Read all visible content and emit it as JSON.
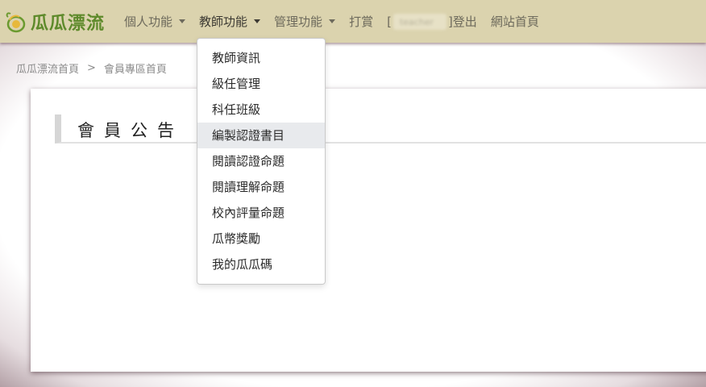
{
  "brand": {
    "name": "瓜瓜漂流",
    "logo_icon": "melon-logo-icon",
    "logo_color": "#5e8a2b"
  },
  "nav": {
    "personal": "個人功能",
    "teacher": "教師功能",
    "admin": "管理功能",
    "tip": "打賞",
    "user_open": "[",
    "user_name": "teacher",
    "user_close": "]",
    "logout": "登出",
    "home": "網站首頁"
  },
  "breadcrumb": {
    "root": "瓜瓜漂流首頁",
    "separator": ">",
    "current": "會員專區首頁"
  },
  "main": {
    "section_title": "會員公告"
  },
  "teacher_menu": {
    "items": [
      {
        "label": "教師資訊"
      },
      {
        "label": "級任管理"
      },
      {
        "label": "科任班級"
      },
      {
        "label": "編製認證書目"
      },
      {
        "label": "閱讀認證命題"
      },
      {
        "label": "閱讀理解命題"
      },
      {
        "label": "校內評量命題"
      },
      {
        "label": "瓜幣獎勵"
      },
      {
        "label": "我的瓜瓜碼"
      }
    ],
    "highlighted_index": 3
  },
  "colors": {
    "navbar_bg": "#dbd3ae",
    "highlight_bg": "#e8eaed",
    "vignette": "#b3a0a6"
  }
}
